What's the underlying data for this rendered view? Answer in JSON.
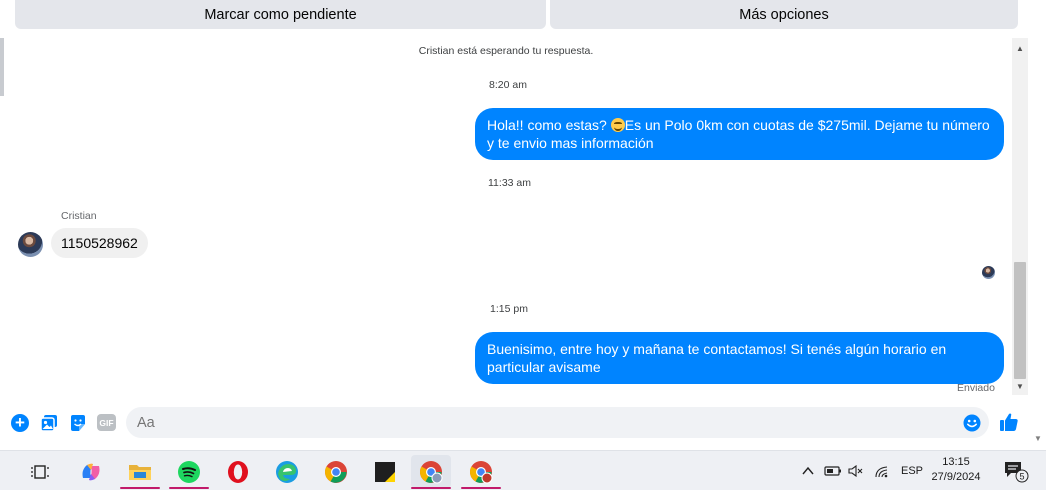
{
  "top_actions": {
    "mark_pending": "Marcar como pendiente",
    "more_options": "Más opciones"
  },
  "conversation": {
    "notice": "Cristian está esperando tu respuesta.",
    "messages": [
      {
        "timestamp": "8:20 am",
        "direction": "outgoing",
        "text_before_emoji": "Hola!! como estas? ",
        "emoji": "smiling-face",
        "text_after_emoji": "Es un Polo 0km con cuotas de $275mil. Dejame tu número y te envio mas información"
      },
      {
        "timestamp": "11:33 am",
        "direction": "incoming",
        "sender": "Cristian",
        "text": "1150528962"
      },
      {
        "timestamp": "1:15 pm",
        "direction": "outgoing",
        "text": "Buenisimo, entre hoy y mañana te contactamos! Si tenés algún horario en particular avisame",
        "status": "Enviado"
      }
    ]
  },
  "composer": {
    "placeholder": "Aa",
    "icons": [
      "plus-icon",
      "photo-icon",
      "sticker-icon",
      "gif-icon",
      "emoji-icon",
      "like-icon"
    ],
    "gif_label": "GIF"
  },
  "colors": {
    "accent": "#0084ff",
    "bubble_incoming": "#f0f0f0",
    "top_button_bg": "#e4e6eb",
    "taskbar_bg": "#eef0f4",
    "taskbar_active_indicator": "#c11a6a"
  },
  "taskbar": {
    "apps": [
      "task-view",
      "copilot",
      "file-explorer",
      "spotify",
      "opera",
      "edge",
      "chrome",
      "sticky-notes",
      "chrome-profile-1",
      "chrome-profile-2"
    ],
    "language": "ESP",
    "time": "13:15",
    "date": "27/9/2024",
    "notification_count": "5"
  }
}
